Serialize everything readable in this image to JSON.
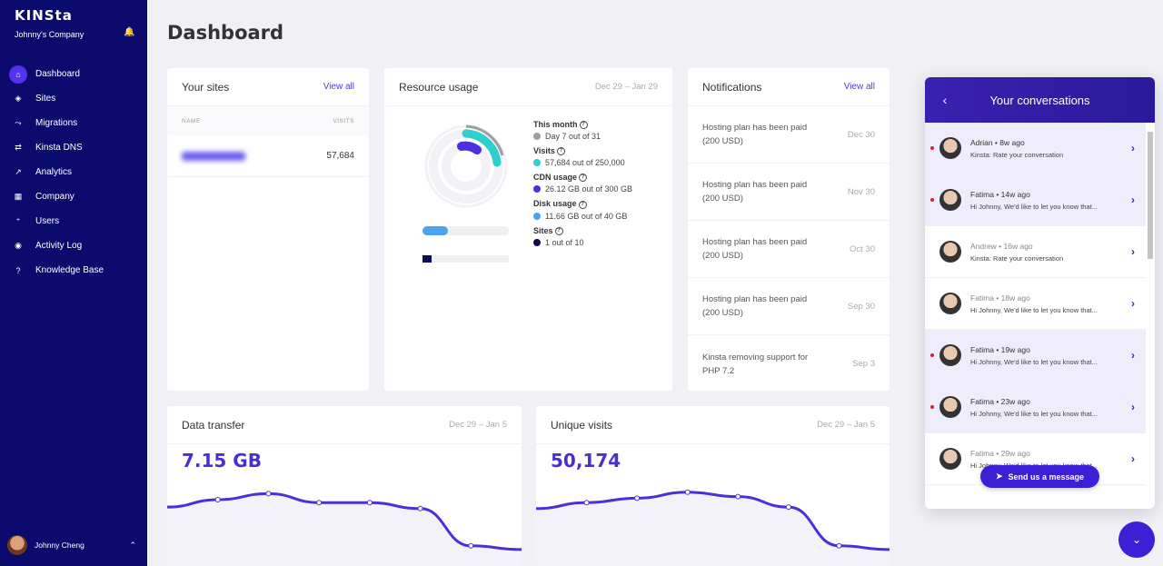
{
  "sidebar": {
    "logo": "KINSta",
    "company": "Johnny's Company",
    "items": [
      {
        "label": "Dashboard",
        "icon": "⌂"
      },
      {
        "label": "Sites",
        "icon": "◈"
      },
      {
        "label": "Migrations",
        "icon": "⤳"
      },
      {
        "label": "Kinsta DNS",
        "icon": "⇄"
      },
      {
        "label": "Analytics",
        "icon": "↗"
      },
      {
        "label": "Company",
        "icon": "▦"
      },
      {
        "label": "Users",
        "icon": "⁺"
      },
      {
        "label": "Activity Log",
        "icon": "◉"
      },
      {
        "label": "Knowledge Base",
        "icon": "?"
      }
    ],
    "user_name": "Johnny Cheng"
  },
  "page_title": "Dashboard",
  "sites": {
    "title": "Your sites",
    "view_all": "View all",
    "col_name": "NAME",
    "col_visits": "VISITS",
    "rows": [
      {
        "name": "blurred",
        "visits": "57,684"
      }
    ]
  },
  "resource": {
    "title": "Resource usage",
    "date": "Dec 29 – Jan 29",
    "items": [
      {
        "label": "This month",
        "value": "Day 7 out of 31",
        "color": "#9e9e9e"
      },
      {
        "label": "Visits",
        "value": "57,684 out of 250,000",
        "color": "#2ecfcf"
      },
      {
        "label": "CDN usage",
        "value": "26.12 GB out of 300 GB",
        "color": "#4a30e0"
      },
      {
        "label": "Disk usage",
        "value": "11.66 GB out of 40 GB",
        "color": "#4aa3f0"
      },
      {
        "label": "Sites",
        "value": "1 out of 10",
        "color": "#0b0b5a"
      }
    ]
  },
  "notifications": {
    "title": "Notifications",
    "view_all": "View all",
    "items": [
      {
        "text": "Hosting plan has been paid (200 USD)",
        "date": "Dec 30"
      },
      {
        "text": "Hosting plan has been paid (200 USD)",
        "date": "Nov 30"
      },
      {
        "text": "Hosting plan has been paid (200 USD)",
        "date": "Oct 30"
      },
      {
        "text": "Hosting plan has been paid (200 USD)",
        "date": "Sep 30"
      },
      {
        "text": "Kinsta removing support for PHP 7.2",
        "date": "Sep 3"
      }
    ]
  },
  "data_transfer": {
    "title": "Data transfer",
    "date": "Dec 29 – Jan 5",
    "value": "7.15 GB",
    "points": [
      0.62,
      0.72,
      0.8,
      0.68,
      0.68,
      0.6,
      0.1,
      0.05
    ]
  },
  "unique_visits": {
    "title": "Unique visits",
    "date": "Dec 29 – Jan 5",
    "value": "50,174",
    "points": [
      0.6,
      0.68,
      0.74,
      0.82,
      0.76,
      0.62,
      0.1,
      0.05
    ]
  },
  "chat": {
    "title": "Your conversations",
    "items": [
      {
        "name": "Adrian • 8w ago",
        "msg": "Kinsta: Rate your conversation",
        "unread": true
      },
      {
        "name": "Fatima • 14w ago",
        "msg": "Hi Johnny, We'd like to let you know that...",
        "unread": true
      },
      {
        "name": "Andrew • 16w ago",
        "msg": "Kinsta: Rate your conversation",
        "unread": false
      },
      {
        "name": "Fatima • 18w ago",
        "msg": "Hi Johnny, We'd like to let you know that...",
        "unread": false
      },
      {
        "name": "Fatima • 19w ago",
        "msg": "Hi Johnny, We'd like to let you know that...",
        "unread": true
      },
      {
        "name": "Fatima • 23w ago",
        "msg": "Hi Johnny, We'd like to let you know that...",
        "unread": true
      },
      {
        "name": "Fatima • 29w ago",
        "msg": "Hi Johnny, We'd like to let you know that...",
        "unread": false
      }
    ],
    "send_label": "Send us a message"
  }
}
